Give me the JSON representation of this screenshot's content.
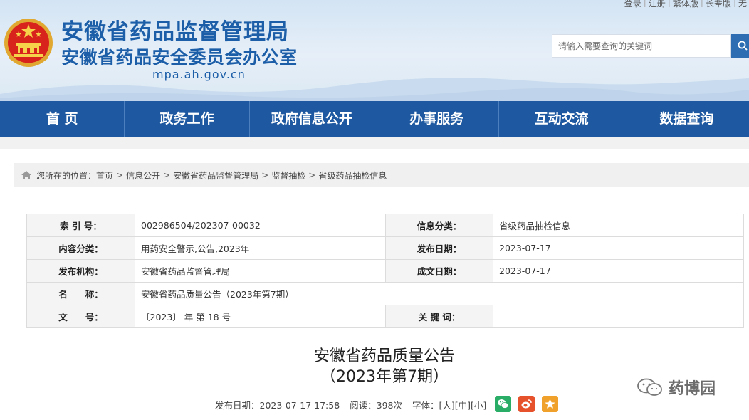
{
  "header": {
    "title_line1": "安徽省药品监督管理局",
    "title_line2": "安徽省药品安全委员会办公室",
    "domain": "mpa.ah.gov.cn",
    "top_links": [
      "登录",
      "注册",
      "繁体版",
      "长辈版",
      "无"
    ],
    "search": {
      "placeholder": "请输入需要查询的关键词"
    }
  },
  "nav": {
    "items": [
      "首 页",
      "政务工作",
      "政府信息公开",
      "办事服务",
      "互动交流",
      "数据查询"
    ]
  },
  "breadcrumb": {
    "prefix": "您所在的位置：",
    "items": [
      "首页",
      "信息公开",
      "安徽省药品监督管理局",
      "监督抽检",
      "省级药品抽检信息"
    ],
    "separator": ">"
  },
  "info": {
    "index_label": "索 引 号：",
    "index_value": "002986504/202307-00032",
    "category_label": "信息分类：",
    "category_value": "省级药品抽检信息",
    "content_label": "内容分类：",
    "content_value": "用药安全警示,公告,2023年",
    "pubdate_label": "发布日期：",
    "pubdate_value": "2023-07-17",
    "org_label": "发布机构：",
    "org_value": "安徽省药品监督管理局",
    "made_label": "成文日期：",
    "made_value": "2023-07-17",
    "name_label": "名　　称：",
    "name_value": "安徽省药品质量公告（2023年第7期）",
    "docno_label": "文　　号：",
    "docno_value": "〔2023〕 年 第 18 号",
    "keyword_label": "关 键 词：",
    "keyword_value": ""
  },
  "article": {
    "title_line1": "安徽省药品质量公告",
    "title_line2": "（2023年第7期）",
    "meta_date": "发布日期：2023-07-17 17:58",
    "meta_reads": "阅读：398次",
    "meta_font_label": "字体：",
    "font_large": "[大]",
    "font_medium": "[中]",
    "font_small": "[小]"
  },
  "watermark": {
    "text": "药博园"
  },
  "colors": {
    "nav_bg": "#1d58a0",
    "title_blue": "#1c5ea8",
    "wechat": "#2aae67",
    "weibo": "#e6522c",
    "favorite": "#f0a12b"
  }
}
